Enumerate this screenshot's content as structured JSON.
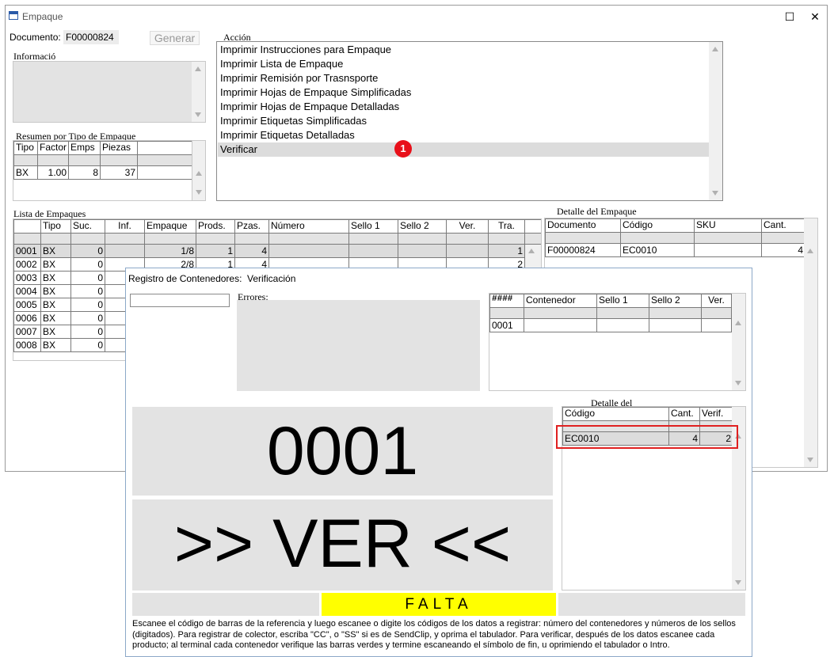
{
  "window": {
    "title": "Empaque",
    "maximize_glyph": "☐",
    "close_glyph": "✕"
  },
  "header": {
    "documento_label": "Documento:",
    "documento_value": "F00000824",
    "generar_label": "Generar"
  },
  "informacion": {
    "label": "Informació"
  },
  "accion": {
    "label": "Acción",
    "items": [
      "Imprimir Instrucciones para Empaque",
      "Imprimir Lista de Empaque",
      "Imprimir Remisión por Trasnsporte",
      "Imprimir Hojas de Empaque Simplificadas",
      "Imprimir Hojas de Empaque Detalladas",
      "Imprimir Etiquetas Simplificadas",
      "Imprimir Etiquetas Detalladas",
      "Verificar"
    ],
    "selected_index": 7,
    "badge": "1"
  },
  "resumen": {
    "label": "Resumen por Tipo de Empaque",
    "columns": [
      "Tipo",
      "Factor",
      "Emps",
      "Piezas"
    ],
    "rows": [
      [
        "BX",
        "1.00",
        "8",
        "37"
      ]
    ]
  },
  "lista": {
    "label": "Lista de Empaques",
    "columns": [
      "Tipo",
      "Suc.",
      "Inf.",
      "Empaque",
      "Prods.",
      "Pzas.",
      "Número",
      "Sello 1",
      "Sello 2",
      "Ver.",
      "Tra."
    ],
    "rows": [
      [
        "0001",
        "BX",
        "0",
        "",
        "1/8",
        "1",
        "4",
        "",
        "",
        "",
        "",
        "1"
      ],
      [
        "0002",
        "BX",
        "0",
        "",
        "2/8",
        "1",
        "4",
        "",
        "",
        "",
        "",
        "2"
      ],
      [
        "0003",
        "BX",
        "0"
      ],
      [
        "0004",
        "BX",
        "0"
      ],
      [
        "0005",
        "BX",
        "0"
      ],
      [
        "0006",
        "BX",
        "0"
      ],
      [
        "0007",
        "BX",
        "0"
      ],
      [
        "0008",
        "BX",
        "0"
      ]
    ]
  },
  "detalle_empaque": {
    "label": "Detalle del Empaque",
    "columns": [
      "Documento",
      "Código",
      "SKU",
      "Cant."
    ],
    "rows": [
      [
        "F00000824",
        "EC0010",
        "",
        "4"
      ]
    ]
  },
  "dialog": {
    "title_left": "Registro de Contenedores:",
    "title_right": "Verificación",
    "input_value": "",
    "errores_label": "Errores:",
    "contenedores": {
      "columns": [
        "####",
        "Contenedor",
        "Sello 1",
        "Sello 2",
        "Ver."
      ],
      "rows": [
        [
          "0001",
          "",
          "",
          "",
          ""
        ]
      ]
    },
    "detalle_label": "Detalle del",
    "detalle": {
      "columns": [
        "Código",
        "Cant.",
        "Verif."
      ],
      "rows": [
        [
          "EC0010",
          "4",
          "2"
        ]
      ]
    },
    "big_number": "0001",
    "big_action": ">> VER <<",
    "status": "FALTA",
    "status_color": "#ffff00",
    "instructions": "Escanee el código de barras de la referencia y luego escanee o digite los códigos de los datos a registrar: número del contenedores y números de los sellos (digitados). Para registrar de colector, escriba \"CC\", o \"SS\" si es de SendClip, y oprima el tabulador. Para verificar, después de los datos escanee cada producto; al terminal cada contenedor verifique las barras verdes y termine escaneando el símbolo de fin, u oprimiendo el tabulador o Intro."
  }
}
